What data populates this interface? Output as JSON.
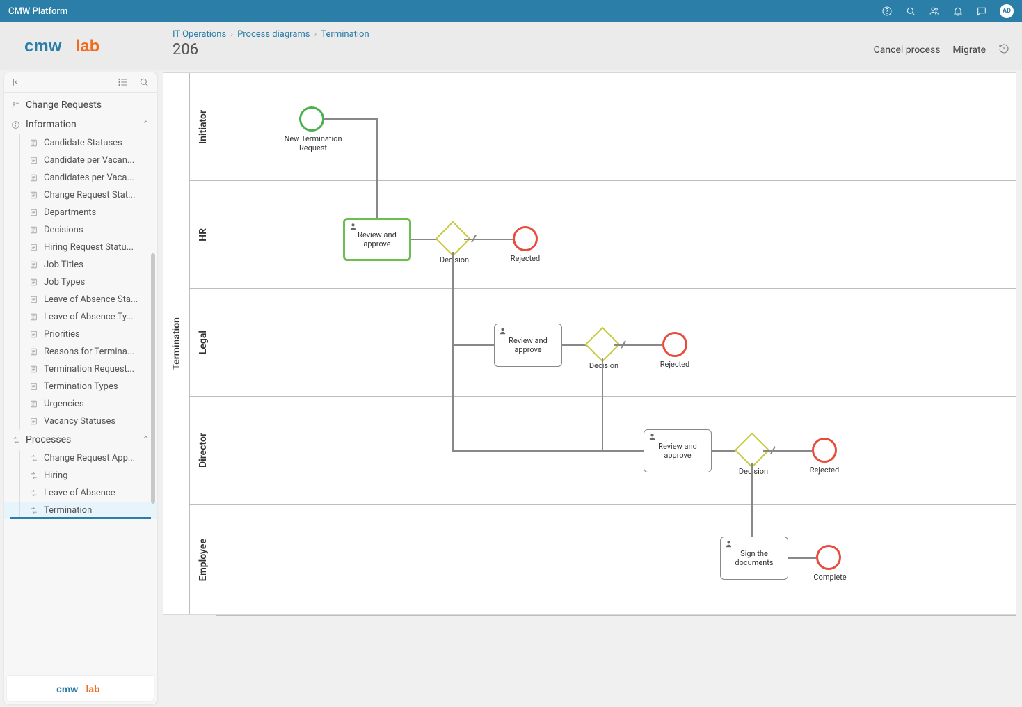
{
  "topbar": {
    "title": "CMW Platform",
    "avatar": "AD"
  },
  "breadcrumbs": [
    "IT Operations",
    "Process diagrams",
    "Termination"
  ],
  "page_id": "206",
  "actions": {
    "cancel": "Cancel process",
    "migrate": "Migrate"
  },
  "sidebar": {
    "change_requests": "Change Requests",
    "information": "Information",
    "info_items": [
      "Candidate Statuses",
      "Candidate per Vacan...",
      "Candidates per Vaca...",
      "Change Request Stat...",
      "Departments",
      "Decisions",
      "Hiring Request Statu...",
      "Job Titles",
      "Job Types",
      "Leave of Absence Sta...",
      "Leave of Absence Ty...",
      "Priorities",
      "Reasons for Termina...",
      "Termination Request...",
      "Termination Types",
      "Urgencies",
      "Vacancy Statuses"
    ],
    "processes": "Processes",
    "process_items": [
      "Change Request App...",
      "Hiring",
      "Leave of Absence",
      "Termination"
    ]
  },
  "diagram": {
    "pool": "Termination",
    "lanes": [
      "Initiator",
      "HR",
      "Legal",
      "Director",
      "Employee"
    ],
    "start_label": "New Termination\nRequest",
    "task_hr": "Review and\napprove",
    "decision": "Decision",
    "rejected": "Rejected",
    "task_legal": "Review and\napprove",
    "task_director": "Review and\napprove",
    "task_employee": "Sign the\ndocuments",
    "complete": "Complete"
  }
}
